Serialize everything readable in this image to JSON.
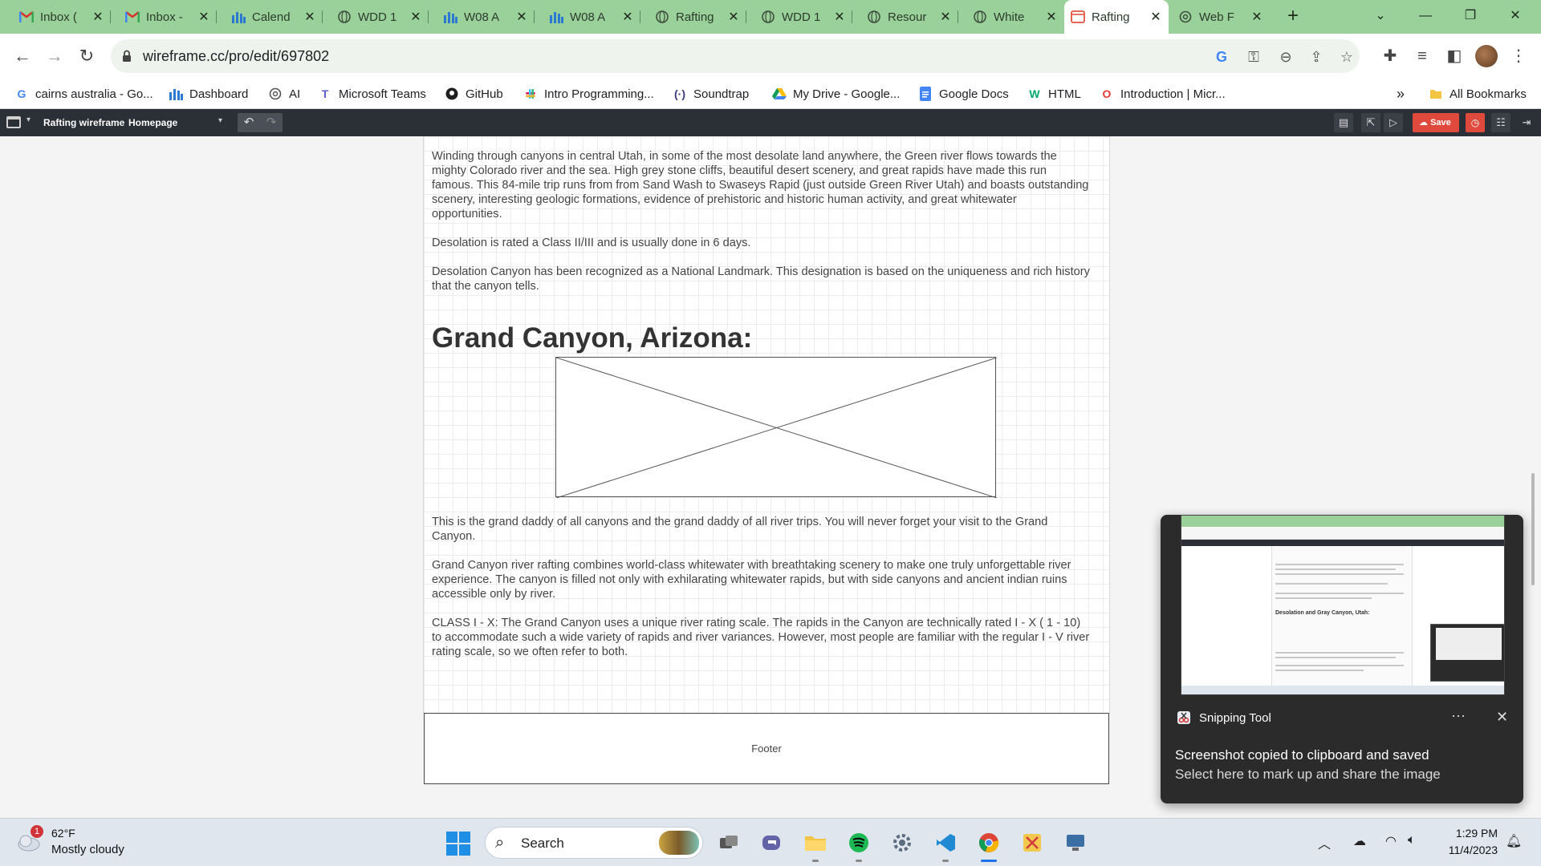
{
  "browser": {
    "tabs": [
      {
        "label": "Inbox (",
        "icon": "gmail-icon"
      },
      {
        "label": "Inbox -",
        "icon": "gmail-icon"
      },
      {
        "label": "Calend",
        "icon": "bar-chart-icon"
      },
      {
        "label": "WDD 1",
        "icon": "globe-icon"
      },
      {
        "label": "W08 A",
        "icon": "bar-chart-icon"
      },
      {
        "label": "W08 A",
        "icon": "bar-chart-icon"
      },
      {
        "label": "Rafting",
        "icon": "globe-icon"
      },
      {
        "label": "WDD 1",
        "icon": "globe-icon"
      },
      {
        "label": "Resour",
        "icon": "globe-icon"
      },
      {
        "label": "White",
        "icon": "globe-icon"
      },
      {
        "label": "Rafting",
        "icon": "wireframe-icon"
      },
      {
        "label": "Web F",
        "icon": "chatgpt-icon"
      }
    ],
    "active_tab": 10,
    "new_tab_symbol": "+",
    "url": "wireframe.cc/pro/edit/697802",
    "bookmarks": [
      {
        "label": "cairns australia - Go...",
        "icon": "google-icon"
      },
      {
        "label": "Dashboard",
        "icon": "bar-chart-icon"
      },
      {
        "label": "AI",
        "icon": "chatgpt-icon"
      },
      {
        "label": "Microsoft Teams",
        "icon": "teams-icon"
      },
      {
        "label": "GitHub",
        "icon": "github-icon"
      },
      {
        "label": "Intro Programming...",
        "icon": "slack-icon"
      },
      {
        "label": "Soundtrap",
        "icon": "soundtrap-icon"
      },
      {
        "label": "My Drive - Google...",
        "icon": "drive-icon"
      },
      {
        "label": "Google Docs",
        "icon": "docs-icon"
      },
      {
        "label": "HTML",
        "icon": "w3-icon"
      },
      {
        "label": "Introduction | Micr...",
        "icon": "opera-icon"
      }
    ],
    "bookmarks_overflow": "»",
    "all_bookmarks": "All Bookmarks"
  },
  "app": {
    "project": "Rafting wireframe",
    "separator": "–",
    "page": "Homepage",
    "save_label": "Save"
  },
  "content": {
    "para1": "Winding through canyons in central Utah, in some of the most desolate land anywhere, the Green river flows towards the mighty Colorado river and the sea. High grey stone cliffs, beautiful desert scenery, and great rapids have made this run famous. This 84-mile trip runs from from Sand Wash to Swaseys Rapid (just outside Green River Utah) and boasts outstanding scenery, interesting geologic formations, evidence of prehistoric and historic human activity, and great whitewater opportunities.",
    "para2": "Desolation is rated a Class II/III and is usually done in 6 days.",
    "para3": "Desolation Canyon has been recognized as a National Landmark. This designation is based on the uniqueness and rich history that the canyon tells.",
    "heading": "Grand Canyon, Arizona:",
    "para4": "This is the grand daddy of all canyons and the grand daddy of all river trips. You will never forget your visit to the Grand Canyon.",
    "para5": "Grand Canyon river rafting combines world-class whitewater with breathtaking scenery to make one truly unforgettable river experience. The canyon is filled not only with exhilarating whitewater rapids, but with side canyons and ancient indian ruins accessible only by river.",
    "para6": "CLASS I - X: The Grand Canyon uses a unique river rating scale. The rapids in the Canyon are technically rated I - X ( 1 - 10) to accommodate such a wide variety of rapids and river variances. However, most people are familiar with the regular I - V river rating scale, so we often refer to both.",
    "footer": "Footer"
  },
  "toast": {
    "app": "Snipping Tool",
    "more": "···",
    "line1": "Screenshot copied to clipboard and saved",
    "line2": "Select here to mark up and share the image",
    "thumb_heading": "Desolation and Gray Canyon, Utah:"
  },
  "taskbar": {
    "weather_badge": "1",
    "temperature": "62°F",
    "condition": "Mostly cloudy",
    "search_label": "Search",
    "time": "1:29 PM",
    "date": "11/4/2023"
  },
  "colors": {
    "tab_strip": "#9ad19a",
    "app_header": "#2b2f36",
    "save_button": "#e04a3c",
    "toast_bg": "#2b2b2b",
    "taskbar": "#dfe6ee"
  }
}
